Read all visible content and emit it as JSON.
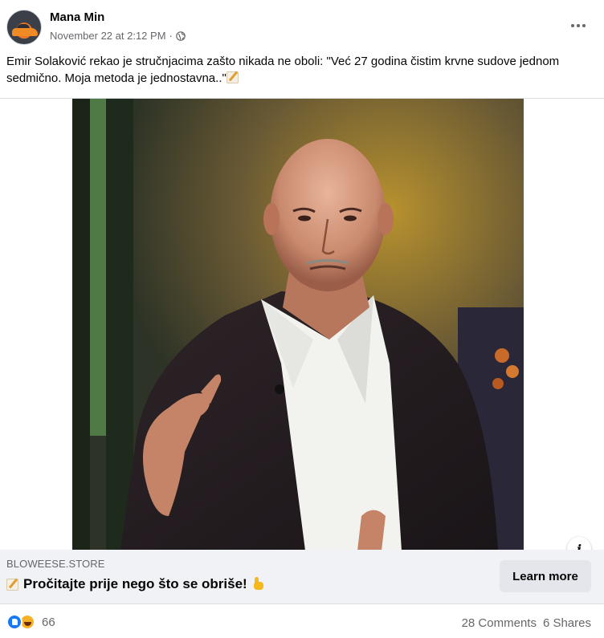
{
  "post": {
    "author": "Mana Min",
    "timestamp": "November 22 at 2:12 PM",
    "separator": "·",
    "privacy_icon": "globe-icon",
    "more_icon": "more-options-icon",
    "caption": "Emir Solaković rekao je stručnjacima zašto nikada ne oboli: \"Već 27 godina čistim krvne sudove jednom sedmično. Moja metoda je jednostavna..\"",
    "caption_emoji": "memo-emoji"
  },
  "ad": {
    "domain": "BLOWEESE.STORE",
    "title": "Pročitajte prije nego što se obriše!",
    "title_leading_emoji": "memo-emoji",
    "title_trailing_emoji": "pointing-down-emoji",
    "cta_label": "Learn more",
    "info_icon": "info-icon",
    "info_label": "i"
  },
  "footer": {
    "reaction_icons": [
      "like-reaction-icon",
      "haha-reaction-icon"
    ],
    "reaction_count": "66",
    "comments": "28 Comments",
    "shares": "6 Shares"
  },
  "colors": {
    "primary_text": "#050505",
    "secondary_text": "#65676b",
    "link_bar_bg": "#f0f2f5",
    "button_bg": "#e4e6eb",
    "like_blue": "#1877f2",
    "haha_yellow": "#f7b125"
  }
}
